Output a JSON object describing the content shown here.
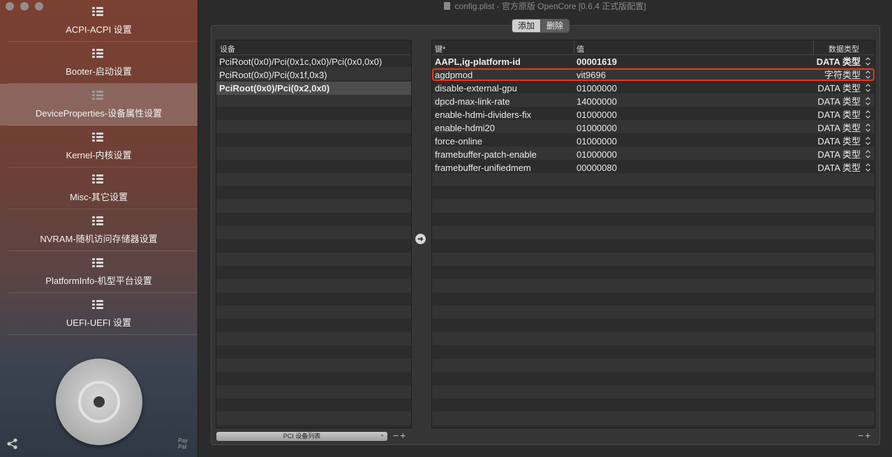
{
  "window": {
    "title": "config.plist - 官方原版 OpenCore [0.6.4 正式版配置]"
  },
  "sidebar": {
    "items": [
      {
        "label": "ACPI-ACPI 设置"
      },
      {
        "label": "Booter-启动设置"
      },
      {
        "label": "DeviceProperties-设备属性设置"
      },
      {
        "label": "Kernel-内核设置"
      },
      {
        "label": "Misc-其它设置"
      },
      {
        "label": "NVRAM-随机访问存储器设置"
      },
      {
        "label": "PlatformInfo-机型平台设置"
      },
      {
        "label": "UEFI-UEFI 设置"
      }
    ],
    "active_index": 2,
    "paypal": "Pay\nPal"
  },
  "toolbar": {
    "add_label": "添加",
    "delete_label": "删除"
  },
  "devices": {
    "header": "设备",
    "rows": [
      "PciRoot(0x0)/Pci(0x1c,0x0)/Pci(0x0,0x0)",
      "PciRoot(0x0)/Pci(0x1f,0x3)",
      "PciRoot(0x0)/Pci(0x2,0x0)"
    ],
    "selected_index": 2,
    "popup_label": "PCI 设备列表",
    "minus": "−",
    "plus": "+"
  },
  "properties": {
    "headers": {
      "key": "键*",
      "value": "值",
      "type": "数据类型"
    },
    "rows": [
      {
        "key": "AAPL,ig-platform-id",
        "value": "00001619",
        "type": "DATA 类型"
      },
      {
        "key": "agdpmod",
        "value": "vit9696",
        "type": "字符类型"
      },
      {
        "key": "disable-external-gpu",
        "value": "01000000",
        "type": "DATA 类型"
      },
      {
        "key": "dpcd-max-link-rate",
        "value": "14000000",
        "type": "DATA 类型"
      },
      {
        "key": "enable-hdmi-dividers-fix",
        "value": "01000000",
        "type": "DATA 类型"
      },
      {
        "key": "enable-hdmi20",
        "value": "01000000",
        "type": "DATA 类型"
      },
      {
        "key": "force-online",
        "value": "01000000",
        "type": "DATA 类型"
      },
      {
        "key": "framebuffer-patch-enable",
        "value": "01000000",
        "type": "DATA 类型"
      },
      {
        "key": "framebuffer-unifiedmem",
        "value": "00000080",
        "type": "DATA 类型"
      }
    ],
    "bold_index": 0,
    "highlight_index": 1,
    "minus": "−",
    "plus": "+"
  },
  "colors": {
    "highlight": "#e03a1f"
  }
}
